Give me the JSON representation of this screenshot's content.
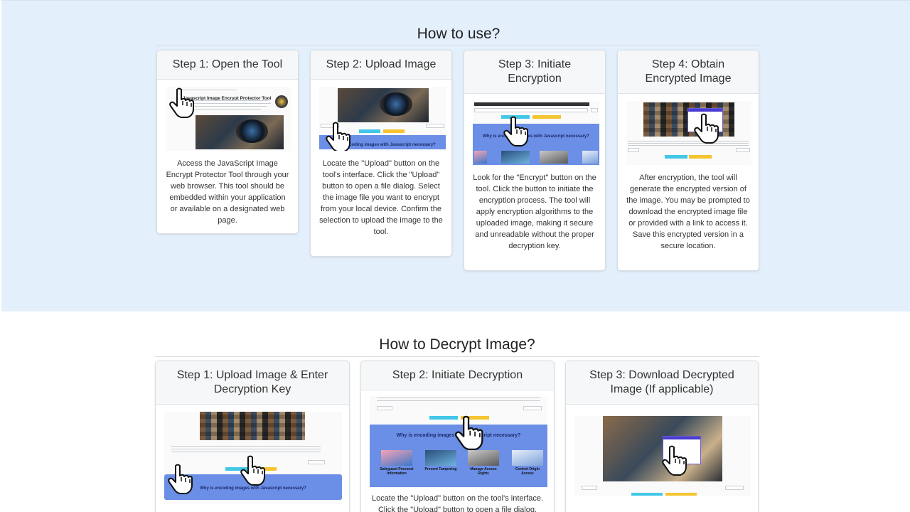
{
  "use_section": {
    "title": "How to use?",
    "cards": [
      {
        "header": "Step 1: Open the Tool",
        "thumb_title": "Javascript Image Encrypt Protector Tool",
        "text": "Access the JavaScript Image Encrypt Protector Tool through your web browser. This tool should be embedded within your application or available on a designated web page."
      },
      {
        "header": "Step 2: Upload Image",
        "thumb_band": "Why is encoding images with Javascript necessary?",
        "text": "Locate the \"Upload\" button on the tool's interface. Click the \"Upload\" button to open a file dialog. Select the image file you want to encrypt from your local device. Confirm the selection to upload the image to the tool."
      },
      {
        "header": "Step 3: Initiate Encryption",
        "thumb_band": "Why is encoding images with Javascript necessary?",
        "text": "Look for the \"Encrypt\" button on the tool. Click the button to initiate the encryption process. The tool will apply encryption algorithms to the uploaded image, making it secure and unreadable without the proper decryption key."
      },
      {
        "header": "Step 4: Obtain Encrypted Image",
        "text": "After encryption, the tool will generate the encrypted version of the image. You may be prompted to download the encrypted image file or provided with a link to access it. Save this encrypted version in a secure location."
      }
    ]
  },
  "decrypt_section": {
    "title": "How to Decrypt Image?",
    "cards": [
      {
        "header": "Step 1: Upload Image & Enter Decryption Key",
        "thumb_band": "Why is encoding images with Javascript necessary?"
      },
      {
        "header": "Step 2: Initiate Decryption",
        "thumb_band": "Why is encoding images with Javascript necessary?",
        "tiles": [
          "Safeguard Personal Information",
          "Prevent Tampering",
          "Manage Access Rights",
          "Control Origin Access"
        ],
        "text": "Locate the \"Upload\" button on the tool's interface. Click the \"Upload\" button to open a file dialog."
      },
      {
        "header": "Step 3: Download Decrypted Image (If applicable)"
      }
    ]
  },
  "colors": {
    "section_bg": "#e3f0fc",
    "band_blue": "#6b8ee6",
    "button_cyan": "#43c7e6",
    "button_yellow": "#f4c431"
  },
  "icons": [
    "pointing-hand-icon"
  ]
}
